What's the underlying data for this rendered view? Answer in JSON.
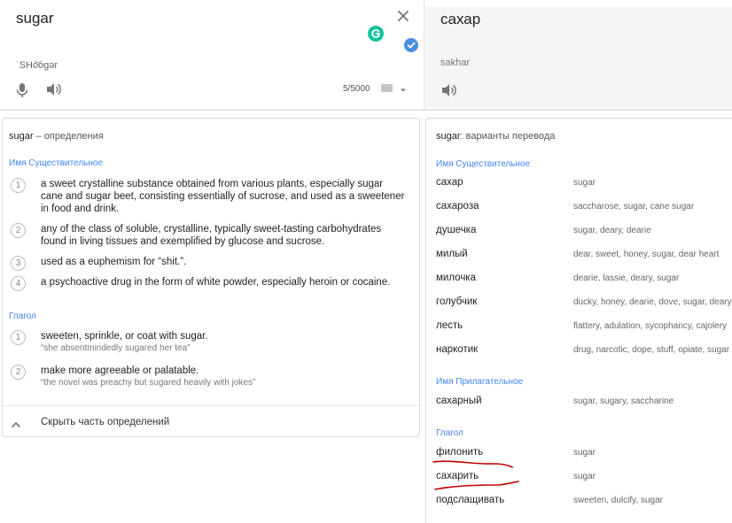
{
  "source": {
    "text": "sugar",
    "transliteration": "ˈSHo͝ogər",
    "char_count": "5/5000"
  },
  "target": {
    "text": "сахар",
    "transliteration": "sakhar"
  },
  "definitions": {
    "title_word": "sugar",
    "title_rest": " – определения",
    "groups": [
      {
        "pos": "Имя Существительное",
        "items": [
          {
            "num": "1",
            "text": "a sweet crystalline substance obtained from various plants, especially sugar cane and sugar beet, consisting essentially of sucrose, and used as a sweetener in food and drink.",
            "example": ""
          },
          {
            "num": "2",
            "text": "any of the class of soluble, crystalline, typically sweet-tasting carbohydrates found in living tissues and exemplified by glucose and sucrose.",
            "example": ""
          },
          {
            "num": "3",
            "text": "used as a euphemism for “shit.”.",
            "example": ""
          },
          {
            "num": "4",
            "text": "a psychoactive drug in the form of white powder, especially heroin or cocaine.",
            "example": ""
          }
        ]
      },
      {
        "pos": "Глагол",
        "items": [
          {
            "num": "1",
            "text": "sweeten, sprinkle, or coat with sugar.",
            "example": "“she absentmindedly sugared her tea”"
          },
          {
            "num": "2",
            "text": "make more agreeable or palatable.",
            "example": "“the novel was preachy but sugared heavily with jokes”"
          }
        ]
      }
    ],
    "collapse_label": "Скрыть часть определений"
  },
  "translations": {
    "title_word": "sugar",
    "title_rest": ": варианты перевода",
    "groups": [
      {
        "pos": "Имя Существительное",
        "rows": [
          {
            "word": "сахар",
            "synonyms": "sugar"
          },
          {
            "word": "сахароза",
            "synonyms": "saccharose, sugar, cane sugar"
          },
          {
            "word": "душечка",
            "synonyms": "sugar, deary, dearie"
          },
          {
            "word": "милый",
            "synonyms": "dear, sweet, honey, sugar, dear heart"
          },
          {
            "word": "милочка",
            "synonyms": "dearie, lassie, deary, sugar"
          },
          {
            "word": "голубчик",
            "synonyms": "ducky, honey, dearie, dove, sugar, deary"
          },
          {
            "word": "лесть",
            "synonyms": "flattery, adulation, sycophancy, cajolery"
          },
          {
            "word": "наркотик",
            "synonyms": "drug, narcotic, dope, stuff, opiate, sugar"
          }
        ]
      },
      {
        "pos": "Имя Прилагательное",
        "rows": [
          {
            "word": "сахарный",
            "synonyms": "sugar, sugary, saccharine"
          }
        ]
      },
      {
        "pos": "Глагол",
        "rows": [
          {
            "word": "филонить",
            "synonyms": "sugar"
          },
          {
            "word": "сахарить",
            "synonyms": "sugar"
          },
          {
            "word": "подслащивать",
            "synonyms": "sweeten, dulcify, sugar"
          }
        ]
      }
    ]
  },
  "icons": {
    "clear": "close-icon",
    "grammarly": "grammarly-icon",
    "verified": "check-circle-icon",
    "mic": "microphone-icon",
    "speaker": "speaker-icon",
    "keyboard": "keyboard-icon",
    "dropdown": "caret-down-icon",
    "collapse": "chevron-up-icon"
  },
  "colors": {
    "pos_header": "#4285f4",
    "grammarly": "#15c39a",
    "verified": "#4a90e2",
    "annotation": "#c00000"
  }
}
